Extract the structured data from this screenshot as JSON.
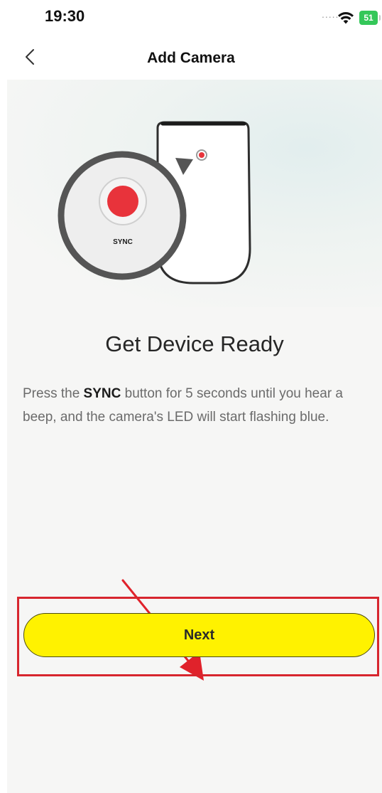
{
  "status_bar": {
    "time": "19:30",
    "signal_dots": ".....",
    "wifi_icon": "wifi-icon",
    "battery_level": "51"
  },
  "nav": {
    "back_icon": "chevron-left-icon",
    "title": "Add Camera"
  },
  "illustration": {
    "sync_label": "SYNC",
    "accent_color": "#e8333b"
  },
  "main": {
    "heading": "Get Device Ready",
    "instruction_prefix": "Press the ",
    "instruction_bold": "SYNC",
    "instruction_suffix": " button for 5 seconds until you hear a beep, and the camera's LED will start flashing blue."
  },
  "actions": {
    "next_label": "Next",
    "button_color": "#fff200",
    "highlight_color": "#d7262e"
  }
}
